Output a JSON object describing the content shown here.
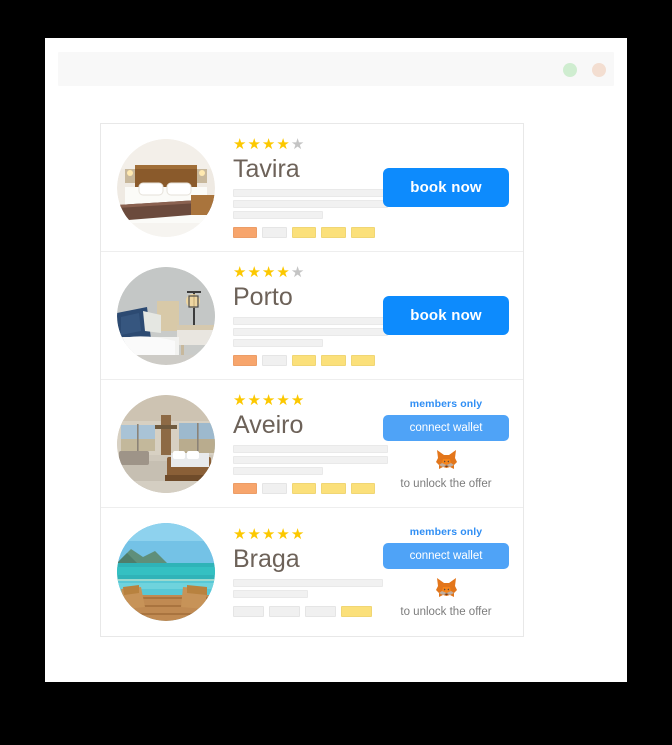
{
  "window": {
    "dots": [
      {
        "name": "window-dot-green",
        "color": "#cfedd0"
      },
      {
        "name": "window-dot-peach",
        "color": "#f3ded1"
      }
    ],
    "toolbar_color": "#f8f8f8"
  },
  "theme": {
    "book_button_blue": "#0d8bfd",
    "wallet_button_blue": "#4fa3f7",
    "members_label_blue": "#2f8ef4",
    "star_on": "#fcc800",
    "star_off": "#c4c4c4",
    "title_color": "#6d6259",
    "chip_orange": "#f7a56c",
    "chip_yellow": "#fbe07a",
    "chip_gray": "#f0f0f0",
    "skeleton_gray": "#f1f1f1"
  },
  "listings": [
    {
      "id": "tavira",
      "name": "Tavira",
      "stars_filled": 4,
      "stars_total": 5,
      "image_alt": "hotel-room-wood-headboard",
      "skeleton_widths": [
        "155px",
        "155px",
        "90px"
      ],
      "chips": [
        "#f7a56c",
        "#f0f0f0",
        "#fbe07a",
        "#fbe07a",
        "#fbe07a"
      ],
      "action": {
        "type": "book",
        "button_label": "book now"
      }
    },
    {
      "id": "porto",
      "name": "Porto",
      "stars_filled": 4,
      "stars_total": 5,
      "image_alt": "modern-bedroom-navy-pillows-lamp",
      "skeleton_widths": [
        "155px",
        "155px",
        "90px"
      ],
      "chips": [
        "#f7a56c",
        "#f0f0f0",
        "#fbe07a",
        "#fbe07a",
        "#fbe07a"
      ],
      "action": {
        "type": "book",
        "button_label": "book now"
      }
    },
    {
      "id": "aveiro",
      "name": "Aveiro",
      "stars_filled": 5,
      "stars_total": 5,
      "image_alt": "luxury-suite-panoramic-windows",
      "skeleton_widths": [
        "155px",
        "155px",
        "90px"
      ],
      "chips": [
        "#f7a56c",
        "#f0f0f0",
        "#fbe07a",
        "#fbe07a",
        "#fbe07a"
      ],
      "action": {
        "type": "wallet",
        "members_label": "members only",
        "button_label": "connect wallet",
        "wallet_icon": "metamask-fox-icon",
        "unlock_text": "to unlock the offer"
      }
    },
    {
      "id": "braga",
      "name": "Braga",
      "stars_filled": 5,
      "stars_total": 5,
      "image_alt": "infinity-pool-ocean-wooden-deck",
      "skeleton_widths": [
        "150px",
        "75px"
      ],
      "chips": [
        "#f0f0f0",
        "#f0f0f0",
        "#f0f0f0",
        "#fbe07a"
      ],
      "action": {
        "type": "wallet",
        "members_label": "members only",
        "button_label": "connect wallet",
        "wallet_icon": "metamask-fox-icon",
        "unlock_text": "to unlock the offer"
      }
    }
  ]
}
